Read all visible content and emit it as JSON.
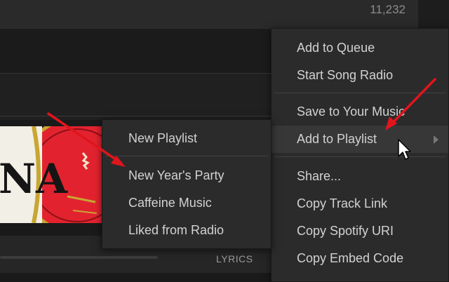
{
  "header": {
    "play_count": "11,232"
  },
  "player": {
    "lyrics_label": "LYRICS"
  },
  "album_art": {
    "letters": "NA"
  },
  "context_menu": {
    "items": [
      {
        "label": "Add to Queue"
      },
      {
        "label": "Start Song Radio"
      },
      {
        "label": "Save to Your Music"
      },
      {
        "label": "Add to Playlist"
      },
      {
        "label": "Share..."
      },
      {
        "label": "Copy Track Link"
      },
      {
        "label": "Copy Spotify URI"
      },
      {
        "label": "Copy Embed Code"
      }
    ]
  },
  "playlist_submenu": {
    "items": [
      {
        "label": "New Playlist"
      },
      {
        "label": "New Year's Party"
      },
      {
        "label": "Caffeine Music"
      },
      {
        "label": "Liked from Radio"
      }
    ]
  },
  "colors": {
    "annotation_arrow": "#e0151b",
    "menu_background": "#2b2b2c",
    "menu_text": "#d2d2d2",
    "album_red": "#e2232f",
    "album_gold": "#c9a632"
  },
  "icons": {
    "submenu_indicator": "chevron-right-icon",
    "pointer": "mouse-cursor-icon"
  }
}
